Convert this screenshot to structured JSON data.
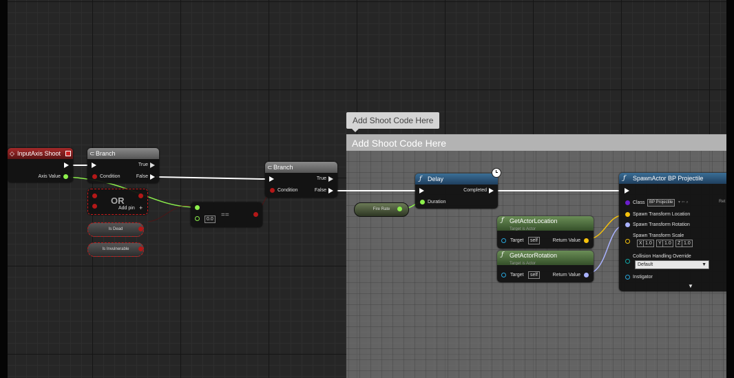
{
  "comment": {
    "bubble": "Add Shoot Code Here",
    "title": "Add Shoot Code Here"
  },
  "input_axis": {
    "title": "InputAxis Shoot",
    "axis_value": "Axis Value"
  },
  "branch1": {
    "title": "Branch",
    "condition": "Condition",
    "true": "True",
    "false": "False"
  },
  "or_node": {
    "symbol": "OR",
    "add_pin": "Add pin"
  },
  "vars": {
    "is_dead": "Is Dead",
    "is_invulnerable": "Is Invulnerable",
    "fire_rate": "Fire Rate"
  },
  "equals": {
    "value": "0.0",
    "symbol": "=="
  },
  "branch2": {
    "title": "Branch",
    "condition": "Condition",
    "true": "True",
    "false": "False"
  },
  "delay": {
    "title": "Delay",
    "completed": "Completed",
    "duration": "Duration"
  },
  "get_location": {
    "title": "GetActorLocation",
    "subtitle": "Target is Actor",
    "target": "Target",
    "self": "self",
    "return_value": "Return Value"
  },
  "get_rotation": {
    "title": "GetActorRotation",
    "subtitle": "Target is Actor",
    "target": "Target",
    "self": "self",
    "return_value": "Return Value"
  },
  "spawn": {
    "title": "SpawnActor BP Projectile",
    "class_label": "Class",
    "class_value": "BP Projectile",
    "ret": "Ret",
    "location": "Spawn Transform Location",
    "rotation": "Spawn Transform Rotation",
    "scale": "Spawn Transform Scale",
    "scale_x_label": "X",
    "scale_x": "1.0",
    "scale_y_label": "Y",
    "scale_y": "1.0",
    "scale_z_label": "Z",
    "scale_z": "1.0",
    "collision": "Collision Handling Override",
    "collision_value": "Default",
    "instigator": "Instigator"
  },
  "colors": {
    "exec": "#ffffff",
    "bool": "#b31818",
    "float": "#8df04c",
    "vector": "#f6c20c",
    "rotator": "#a9b2ff",
    "object": "#27a7dd"
  },
  "icons": [
    "event-icon",
    "branch-icon",
    "function-icon",
    "clock-icon",
    "expand-arrow-icon"
  ]
}
